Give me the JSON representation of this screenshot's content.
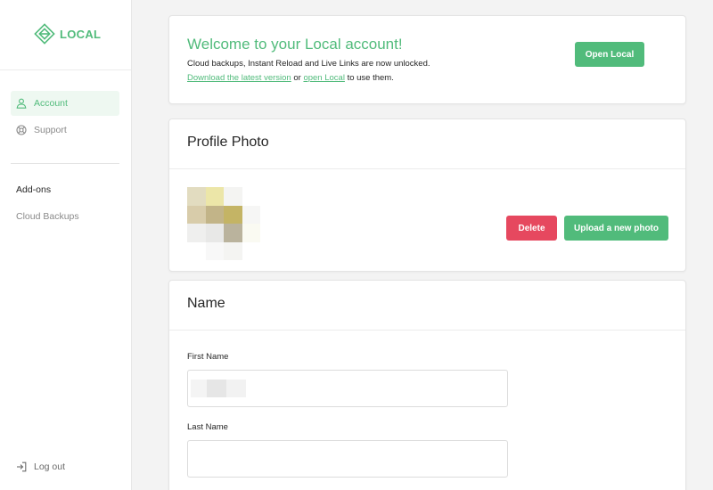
{
  "app": {
    "logo_text": "LOCAL",
    "accent": "#51bb7b",
    "danger": "#e6485f"
  },
  "sidebar": {
    "nav": [
      {
        "label": "Account",
        "icon": "user-icon",
        "active": true
      },
      {
        "label": "Support",
        "icon": "lifebuoy-icon",
        "active": false
      }
    ],
    "addons": {
      "heading": "Add-ons",
      "items": [
        {
          "label": "Cloud Backups"
        }
      ]
    },
    "logout": {
      "label": "Log out",
      "icon": "logout-icon"
    }
  },
  "welcome": {
    "title": "Welcome to your Local account!",
    "line1": "Cloud backups, Instant Reload and Live Links are now unlocked.",
    "link1": "Download the latest version",
    "between": " or ",
    "link2": "open Local",
    "suffix": " to use them.",
    "button": "Open Local"
  },
  "profile_photo": {
    "title": "Profile Photo",
    "delete_label": "Delete",
    "upload_label": "Upload a new photo"
  },
  "name_section": {
    "title": "Name",
    "first_name_label": "First Name",
    "first_name_value": "",
    "last_name_label": "Last Name",
    "last_name_value": ""
  }
}
